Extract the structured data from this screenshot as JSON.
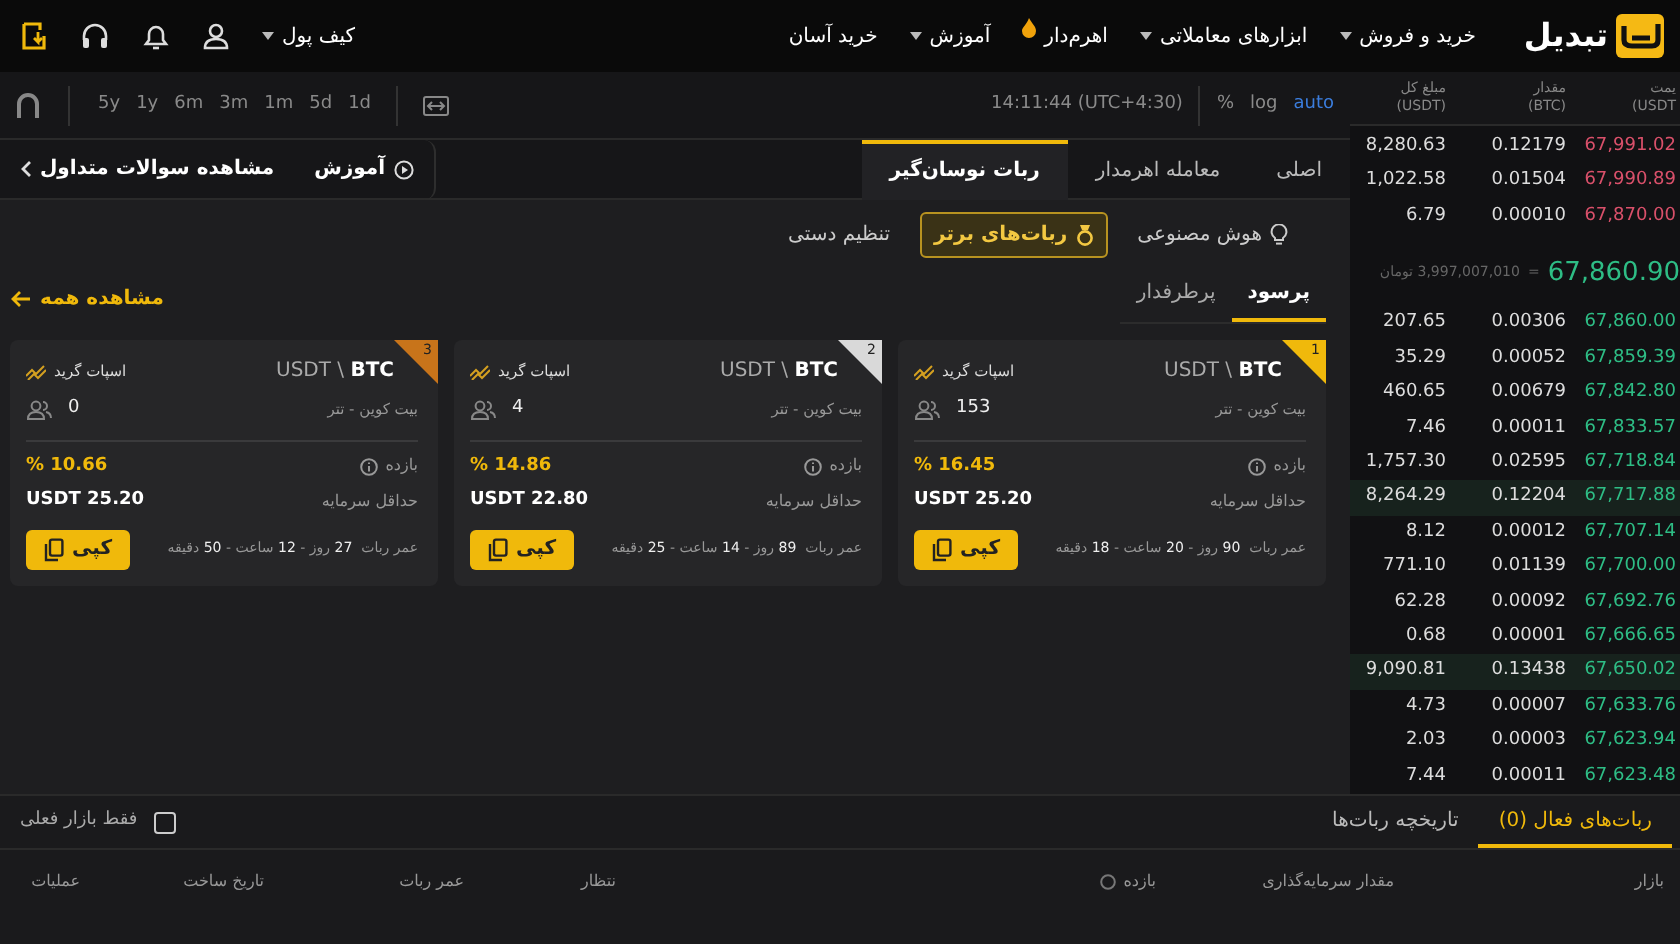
{
  "header": {
    "logo": "تبدیل",
    "nav": [
      {
        "label": "خرید و فروش",
        "dropdown": true,
        "hot": false
      },
      {
        "label": "ابزارهای معاملاتی",
        "dropdown": true,
        "hot": false
      },
      {
        "label": "اهرم‌دار",
        "dropdown": false,
        "hot": true
      },
      {
        "label": "آموزش",
        "dropdown": true,
        "hot": false
      },
      {
        "label": "خرید آسان",
        "dropdown": false,
        "hot": false
      }
    ],
    "wallet": "کیف پول"
  },
  "chart_toolbar": {
    "timeframes": [
      "1d",
      "5d",
      "1m",
      "3m",
      "6m",
      "1y",
      "5y"
    ],
    "time": "14:11:44 (UTC+4:30)",
    "options": [
      {
        "label": "auto",
        "selected": true
      },
      {
        "label": "log",
        "selected": false
      },
      {
        "label": "%",
        "selected": false
      }
    ]
  },
  "panel_tabs": [
    {
      "label": "اصلی",
      "selected": false
    },
    {
      "label": "معامله اهرمدار",
      "selected": false
    },
    {
      "label": "ربات نوسان‌گیر",
      "selected": true
    }
  ],
  "help_links": [
    "آموزش",
    "مشاهده سوالات متداول"
  ],
  "bot_categories": [
    {
      "label": "هوش مصنوعی",
      "selected": false
    },
    {
      "label": "ربات‌های برتر",
      "selected": true
    },
    {
      "label": "تنظیم دستی",
      "selected": false
    }
  ],
  "sort_tabs": [
    {
      "label": "پرسود",
      "selected": true
    },
    {
      "label": "پرطرفدار",
      "selected": false
    }
  ],
  "see_all": "مشاهده همه",
  "bots": [
    {
      "rank": "1",
      "color": "#f0b90b",
      "pair": "USDT \\ **BTC**",
      "type": "اسپات گرید",
      "pair_name": "بیت کوین - تتر",
      "users": "153",
      "yield_label": "بازده",
      "yield": "16.45 %",
      "min_label": "حداقل سرمایه",
      "min": "25.20 USDT",
      "age_label": "عمر ربات",
      "age": "**90** روز - **20** ساعت - **18** دقیقه",
      "button": "کپی"
    },
    {
      "rank": "2",
      "color": "#d9d9d9",
      "pair": "USDT \\ **BTC**",
      "type": "اسپات گرید",
      "pair_name": "بیت کوین - تتر",
      "users": "4",
      "yield_label": "بازده",
      "yield": "14.86 %",
      "min_label": "حداقل سرمایه",
      "min": "22.80 USDT",
      "age_label": "عمر ربات",
      "age": "**89** روز - **14** ساعت - **25** دقیقه",
      "button": "کپی"
    },
    {
      "rank": "3",
      "color": "#c8741a",
      "pair": "USDT \\ **BTC**",
      "type": "اسپات گرید",
      "pair_name": "بیت کوین - تتر",
      "users": "0",
      "yield_label": "بازده",
      "yield": "10.66 %",
      "min_label": "حداقل سرمایه",
      "min": "25.20 USDT",
      "age_label": "عمر ربات",
      "age": "**27** روز - **12** ساعت - **50** دقیقه",
      "button": "کپی"
    }
  ],
  "order_book": {
    "columns": [
      {
        "label": "یمت",
        "unit": "(USDT"
      },
      {
        "label": "مقدار",
        "unit": "(BTC)"
      },
      {
        "label": "مبلغ کل",
        "unit": "(USDT)"
      }
    ],
    "asks": [
      {
        "price": "67,991.02",
        "amount": "0.12179",
        "total": "8,280.63"
      },
      {
        "price": "67,990.89",
        "amount": "0.01504",
        "total": "1,022.58"
      },
      {
        "price": "67,870.00",
        "amount": "0.00010",
        "total": "6.79"
      }
    ],
    "mid": {
      "price": "67,860.90",
      "equals": "=",
      "toman": "3,997,007,010 تومان"
    },
    "bids": [
      {
        "price": "67,860.00",
        "amount": "0.00306",
        "total": "207.65",
        "highlighted": false
      },
      {
        "price": "67,859.39",
        "amount": "0.00052",
        "total": "35.29",
        "highlighted": false
      },
      {
        "price": "67,842.80",
        "amount": "0.00679",
        "total": "460.65",
        "highlighted": false
      },
      {
        "price": "67,833.57",
        "amount": "0.00011",
        "total": "7.46",
        "highlighted": false
      },
      {
        "price": "67,718.84",
        "amount": "0.02595",
        "total": "1,757.30",
        "highlighted": false
      },
      {
        "price": "67,717.88",
        "amount": "0.12204",
        "total": "8,264.29",
        "highlighted": true
      },
      {
        "price": "67,707.14",
        "amount": "0.00012",
        "total": "8.12",
        "highlighted": false
      },
      {
        "price": "67,700.00",
        "amount": "0.01139",
        "total": "771.10",
        "highlighted": false
      },
      {
        "price": "67,692.76",
        "amount": "0.00092",
        "total": "62.28",
        "highlighted": false
      },
      {
        "price": "67,666.65",
        "amount": "0.00001",
        "total": "0.68",
        "highlighted": false
      },
      {
        "price": "67,650.02",
        "amount": "0.13438",
        "total": "9,090.81",
        "highlighted": true
      },
      {
        "price": "67,633.76",
        "amount": "0.00007",
        "total": "4.73",
        "highlighted": false
      },
      {
        "price": "67,623.94",
        "amount": "0.00003",
        "total": "2.03",
        "highlighted": false
      },
      {
        "price": "67,623.48",
        "amount": "0.00011",
        "total": "7.44",
        "highlighted": false
      }
    ]
  },
  "bottom": {
    "tabs": [
      {
        "label": "ربات‌های فعال (0)",
        "selected": true
      },
      {
        "label": "تاریخچه ربات‌ها",
        "selected": false
      }
    ],
    "filter": {
      "label": "فقط بازار فعلی",
      "checked": false
    },
    "columns": [
      {
        "label": "بازار",
        "info": false
      },
      {
        "label": "مقدار سرمایه‌گذاری",
        "info": false
      },
      {
        "label": "بازده",
        "info": true
      },
      {
        "label": "نتظار",
        "info": false
      },
      {
        "label": "عمر ربات",
        "info": false
      },
      {
        "label": "تاریخ ساخت",
        "info": false
      },
      {
        "label": "عملیات",
        "info": false
      }
    ]
  }
}
